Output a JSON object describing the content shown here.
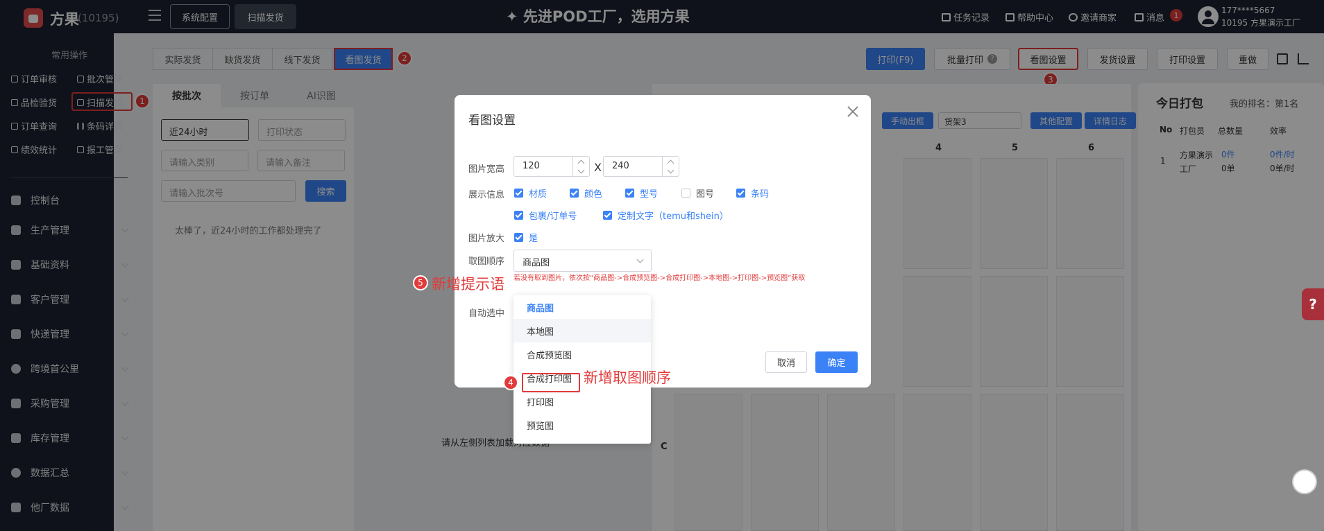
{
  "header": {
    "brand": "方果",
    "brand_id": "(10195)",
    "tab_system": "系统配置",
    "tab_scan": "扫描发货",
    "slogan": "✦ 先进POD工厂，选用方果",
    "task_log": "任务记录",
    "help_center": "帮助中心",
    "invite": "邀请商家",
    "messages": "消息",
    "message_count": "1",
    "user_phone": "177****5667",
    "user_name": "10195 方果演示工厂"
  },
  "sidebar": {
    "section_title": "常用操作",
    "quick": [
      "订单审核",
      "批次管理",
      "品检验货",
      "扫描发货",
      "订单查询",
      "条码详情",
      "绩效统计",
      "报工管理"
    ],
    "nav": [
      "控制台",
      "生产管理",
      "基础资料",
      "客户管理",
      "快递管理",
      "跨境首公里",
      "采购管理",
      "库存管理",
      "数据汇总",
      "他厂数据"
    ]
  },
  "tabs": [
    "实际发货",
    "缺货发货",
    "线下发货",
    "看图发货"
  ],
  "toolbar": {
    "print": "打印(F9)",
    "batch_print": "批量打印",
    "view_settings": "看图设置",
    "ship_settings": "发货设置",
    "print_settings": "打印设置",
    "reset": "重做"
  },
  "left_panel": {
    "tabs": [
      "按批次",
      "按订单",
      "AI识图"
    ],
    "time_select": "近24小时",
    "print_status_placeholder": "打印状态",
    "category_placeholder": "请输入类别",
    "remark_placeholder": "请输入备注",
    "batch_placeholder": "请输入批次号",
    "search": "搜索",
    "empty_msg": "太棒了，近24小时的工作都处理完了",
    "select_hint": "请从左侧列表加载对应数据"
  },
  "mid_panel": {
    "manual_out": "手动出框",
    "shelf_select": "货架3",
    "other_config": "其他配置",
    "detail_log": "详情日志",
    "col_headers": [
      "4",
      "5",
      "6"
    ],
    "row_label": "C"
  },
  "today_card": {
    "title": "今日打包",
    "rank_label": "我的排名：第1名",
    "columns": [
      "No",
      "打包员",
      "总数量",
      "效率"
    ],
    "row": {
      "no": "1",
      "packer": "方果演示工厂",
      "total": "0件",
      "total2": "0单",
      "eff": "0件/时",
      "eff2": "0单/时"
    }
  },
  "modal": {
    "title": "看图设置",
    "size_label": "图片宽高",
    "width": "120",
    "times": "X",
    "height": "240",
    "display_label": "展示信息",
    "display_options": [
      {
        "label": "材质",
        "checked": true
      },
      {
        "label": "颜色",
        "checked": true
      },
      {
        "label": "型号",
        "checked": true
      },
      {
        "label": "图号",
        "checked": false
      },
      {
        "label": "条码",
        "checked": true
      },
      {
        "label": "包裹/订单号",
        "checked": true
      },
      {
        "label": "定制文字（temu和shein）",
        "checked": true
      }
    ],
    "zoom_label": "图片放大",
    "zoom_value": "是",
    "order_label": "取图顺序",
    "order_value": "商品图",
    "warning": "若没有取到图片，依次按“商品图->合成预览图->合成打印图->本地图->打印图->预览图”获取",
    "auto_label": "自动选中",
    "cancel": "取消",
    "ok": "确定"
  },
  "dropdown": {
    "options": [
      "商品图",
      "本地图",
      "合成预览图",
      "合成打印图",
      "打印图",
      "预览图"
    ],
    "selected": "商品图"
  },
  "annotations": {
    "m1": "1",
    "m2": "2",
    "m3": "3",
    "m4": "4",
    "m5": "5",
    "new_hint": "新增提示语",
    "new_order": "新增取图顺序"
  }
}
